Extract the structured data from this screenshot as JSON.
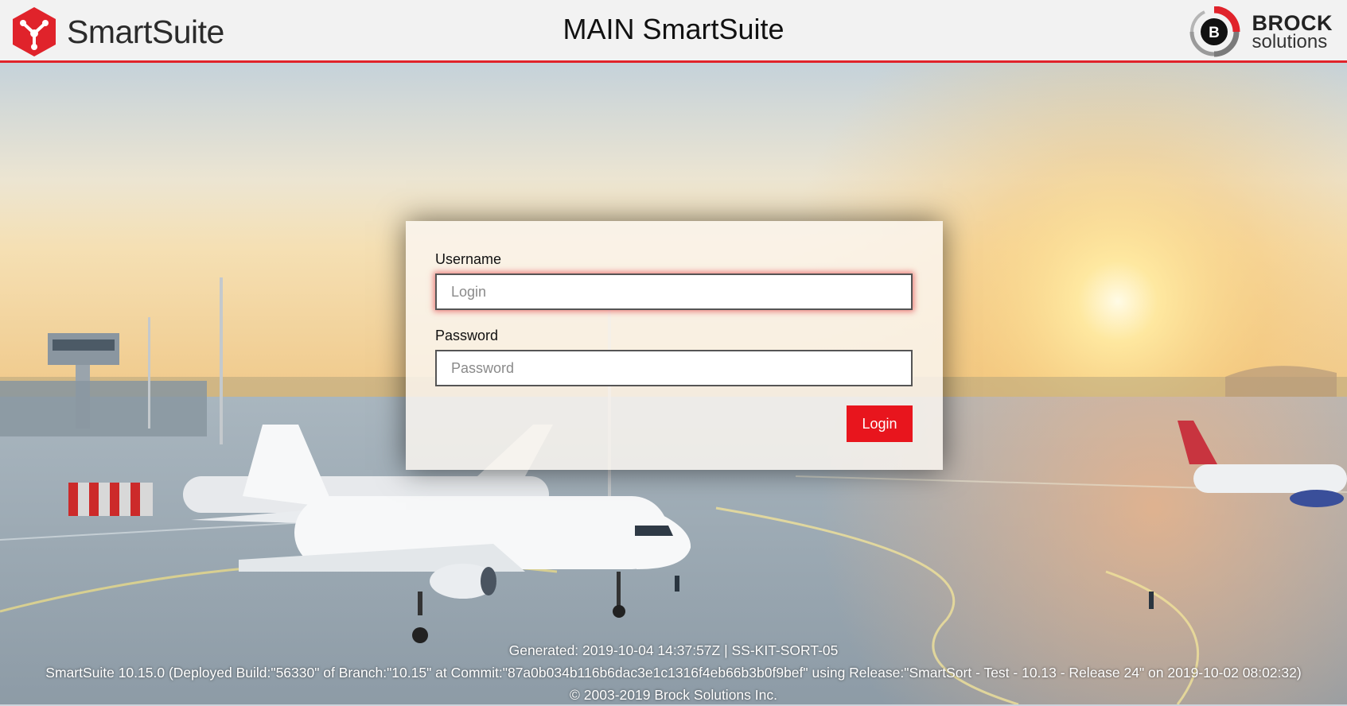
{
  "header": {
    "brand_name": "SmartSuite",
    "brand_icon": "smartsuite-logo-icon",
    "title": "MAIN SmartSuite",
    "partner_logo": {
      "icon": "brock-b-logo-icon",
      "letter": "B",
      "name": "BROCK",
      "sub": "solutions"
    },
    "accent_color": "#e0232b"
  },
  "login": {
    "username_label": "Username",
    "username_placeholder": "Login",
    "username_value": "",
    "password_label": "Password",
    "password_placeholder": "Password",
    "password_value": "",
    "submit_label": "Login",
    "button_color": "#e8151d"
  },
  "footer": {
    "generated": "Generated: 2019-10-04 14:37:57Z | SS-KIT-SORT-05",
    "version": "SmartSuite 10.15.0 (Deployed Build:\"56330\" of Branch:\"10.15\" at Commit:\"87a0b034b116b6dac3e1c1316f4eb66b3b0f9bef\" using Release:\"SmartSort - Test - 10.13 - Release 24\" on 2019-10-02 08:02:32)",
    "copyright": "© 2003-2019 Brock Solutions Inc."
  }
}
